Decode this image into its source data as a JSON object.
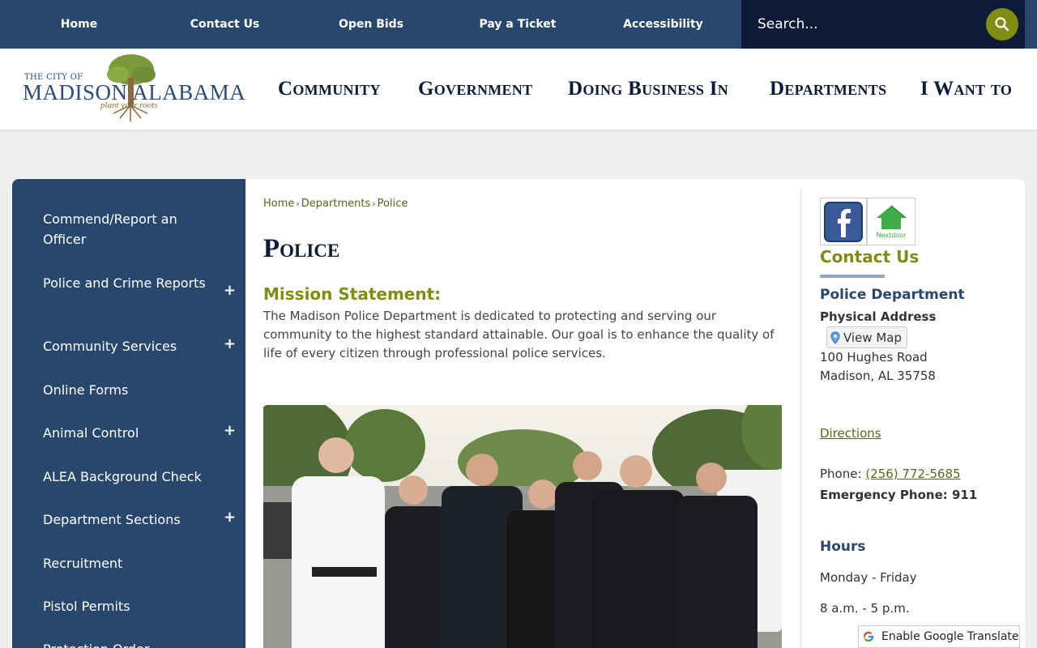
{
  "topnav": {
    "items": [
      "Home",
      "Contact Us",
      "Open Bids",
      "Pay a Ticket",
      "Accessibility"
    ],
    "search_placeholder": "Search..."
  },
  "logo": {
    "line1": "THE CITY OF",
    "line2": "MADISON ALABAMA",
    "tagline": "plant your roots"
  },
  "mainnav": {
    "items": [
      "Community",
      "Government",
      "Doing Business In",
      "Departments",
      "I Want to"
    ]
  },
  "sidebar": {
    "items": [
      {
        "label": "Commend/Report an Officer",
        "expandable": false
      },
      {
        "label": "Police and Crime Reports",
        "expandable": true
      },
      {
        "label": "Community Services",
        "expandable": true
      },
      {
        "label": "Online Forms",
        "expandable": false
      },
      {
        "label": "Animal Control",
        "expandable": true
      },
      {
        "label": "ALEA Background Check",
        "expandable": false
      },
      {
        "label": "Department Sections",
        "expandable": true
      },
      {
        "label": "Recruitment",
        "expandable": false
      },
      {
        "label": "Pistol Permits",
        "expandable": false
      },
      {
        "label": "Protection Order",
        "expandable": false
      }
    ],
    "expand_symbol": "+"
  },
  "breadcrumb": [
    "Home",
    "Departments",
    "Police"
  ],
  "breadcrumb_sep": "›",
  "page": {
    "title": "Police",
    "mission_heading": "Mission Statement:",
    "mission_text": "The Madison Police Department is dedicated to protecting and serving our community to the highest standard attainable. Our goal is to enhance the quality of life of every citizen through professional police services."
  },
  "social": {
    "facebook_icon": "facebook-icon",
    "nextdoor_label": "Nextdoor"
  },
  "contact": {
    "title": "Contact Us",
    "dept": "Police Department",
    "phys_label": "Physical Address",
    "view_map": "View Map",
    "address_line1": "100 Hughes Road",
    "address_line2": "Madison, AL 35758",
    "directions": "Directions",
    "phone_label": "Phone:",
    "phone": "(256) 772-5685",
    "emergency": "Emergency Phone: 911",
    "hours_title": "Hours",
    "hours_days": "Monday - Friday",
    "hours_time": "8 a.m. - 5 p.m."
  },
  "translate": "Enable Google Translate",
  "colors": {
    "nav_blue": "#28476d",
    "navy": "#0d1b38",
    "olive": "#7f8d12"
  }
}
